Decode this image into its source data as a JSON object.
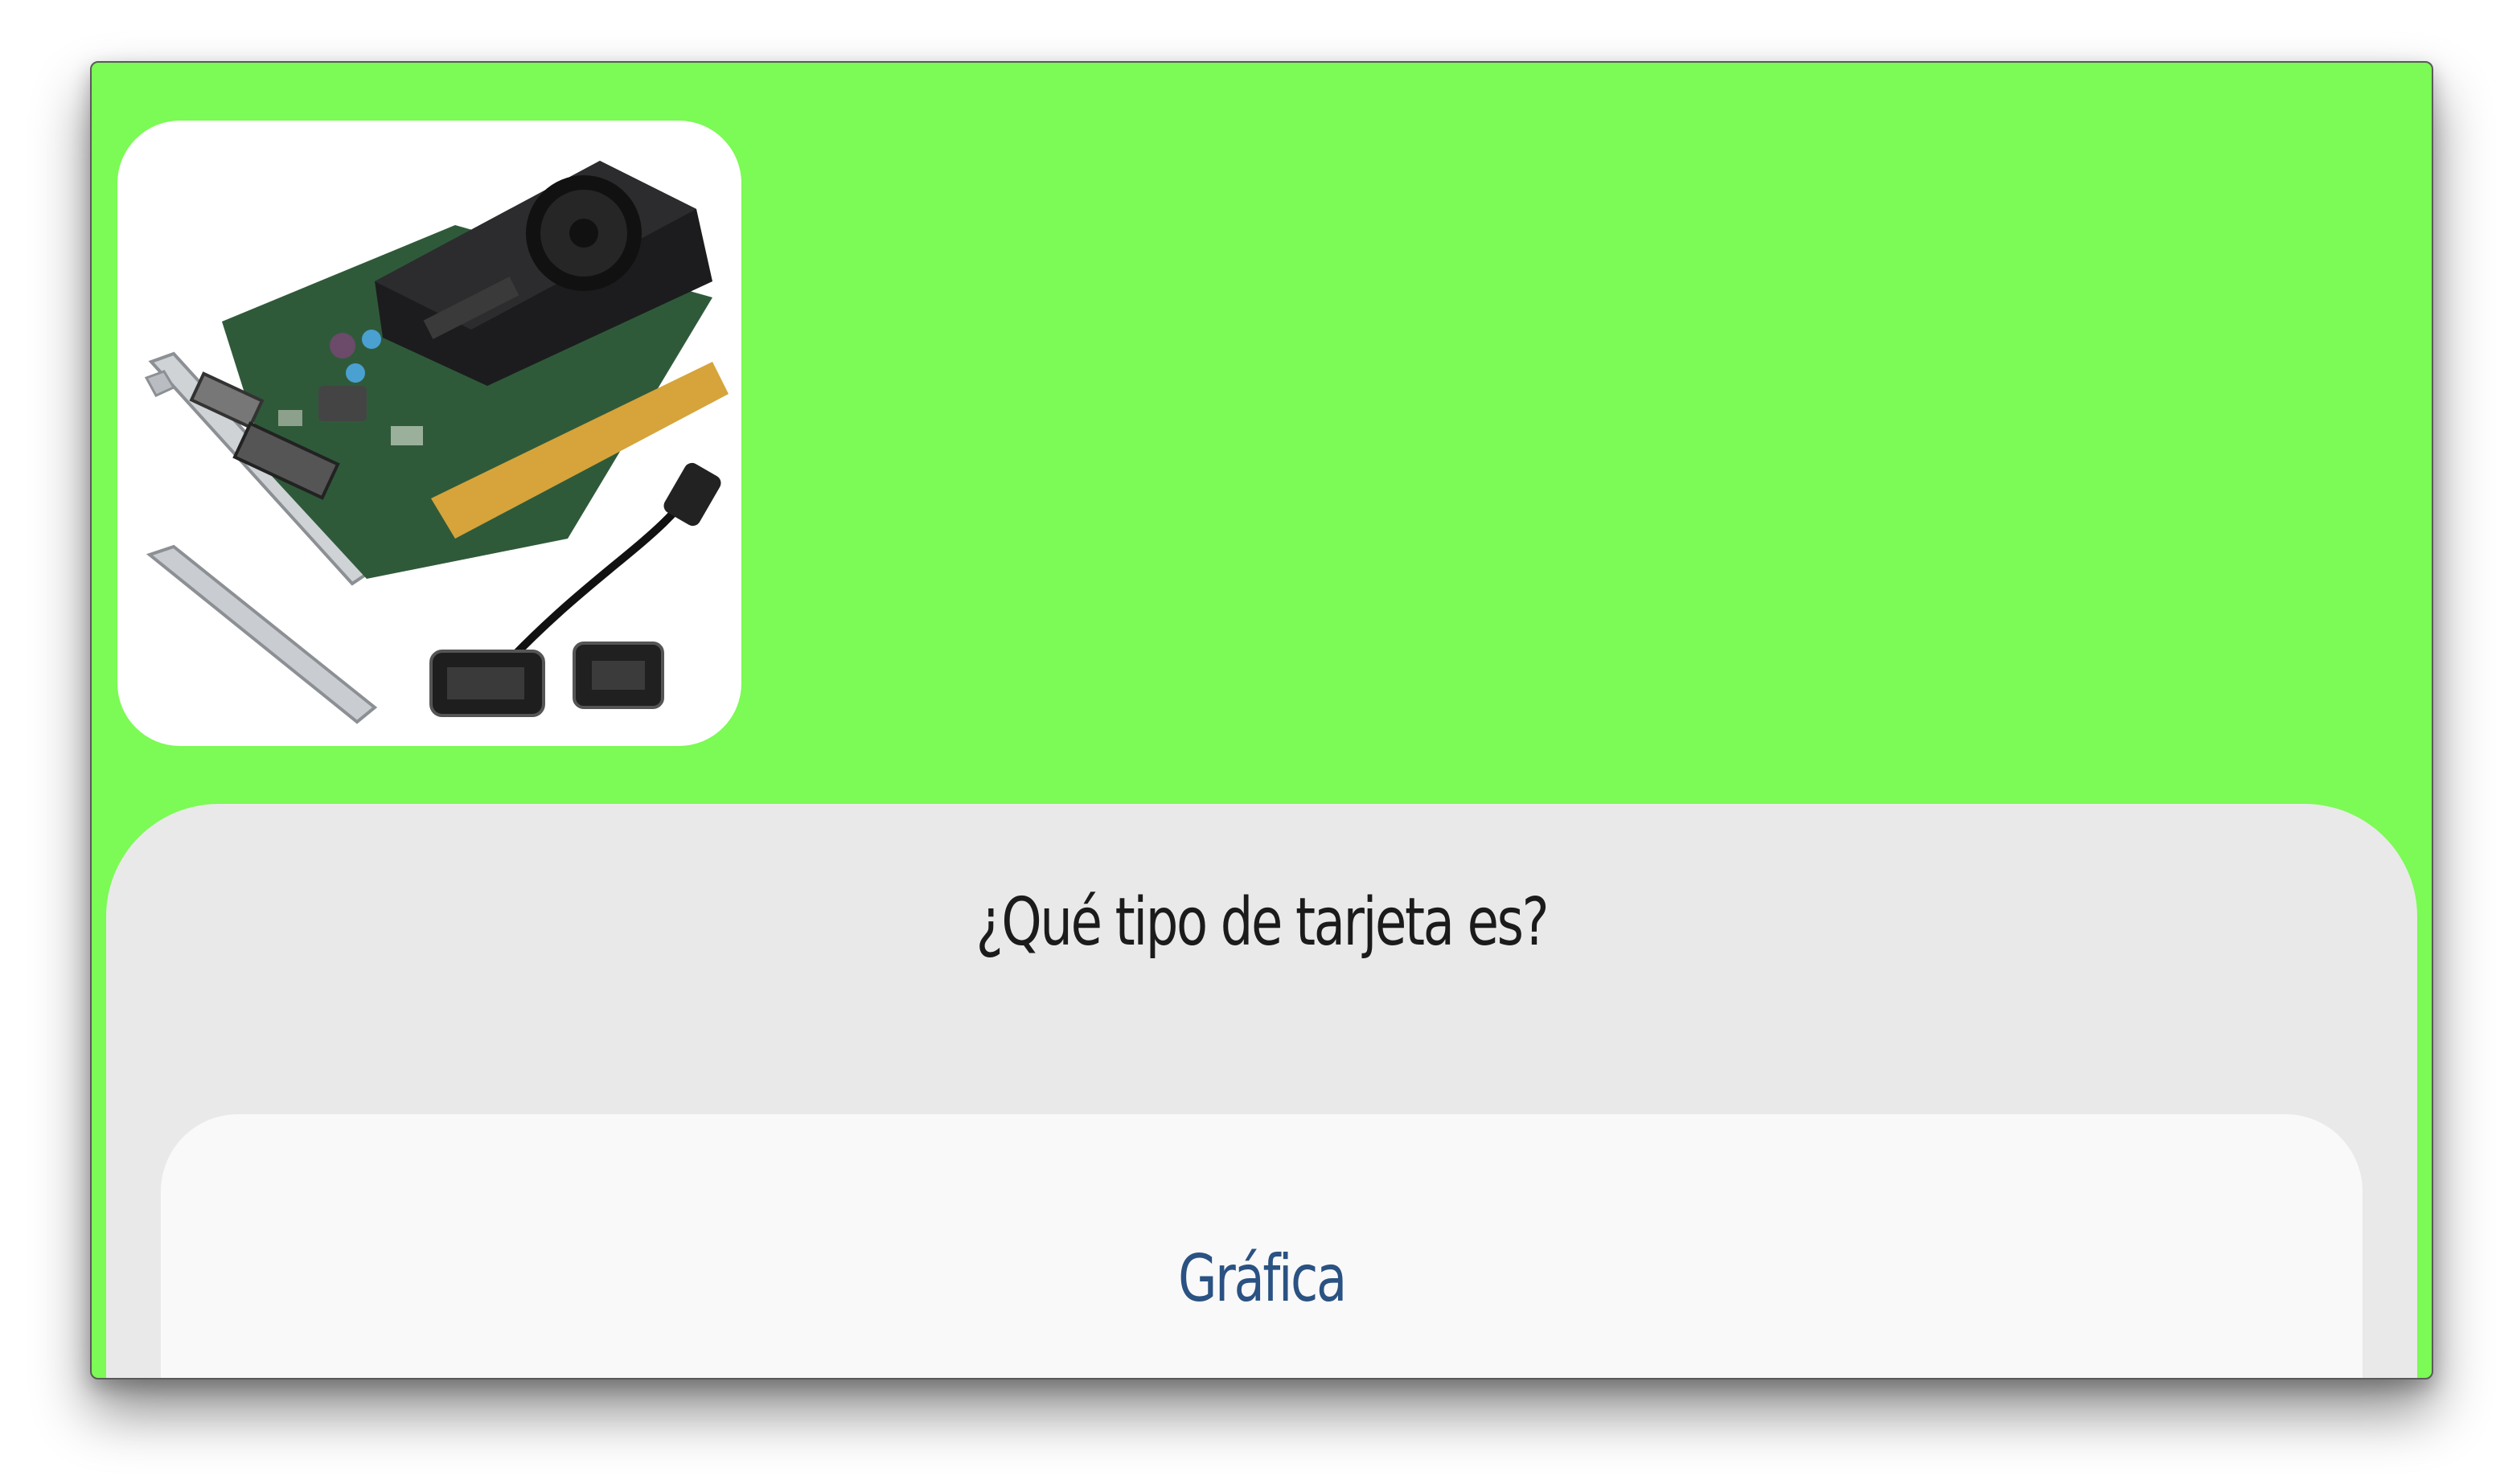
{
  "quiz": {
    "image_alt": "graphics-card-image",
    "question": "¿Qué tipo de tarjeta es?",
    "answers": [
      {
        "label": "Gráfica"
      }
    ]
  },
  "colors": {
    "background": "#7cfa55",
    "panel": "#e9e9e9",
    "answer_button": "#f9f9f9",
    "answer_text": "#2a5282",
    "question_text": "#1b1b1b"
  }
}
